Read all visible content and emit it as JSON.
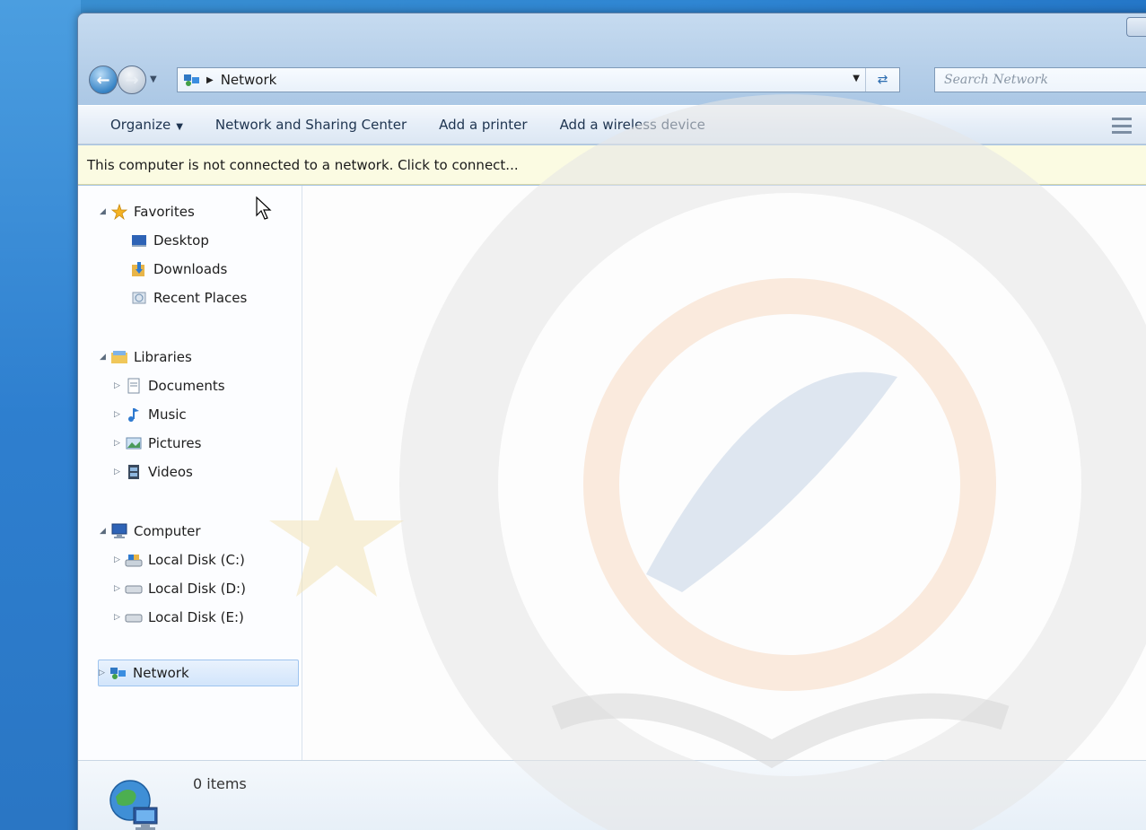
{
  "address_bar": {
    "location": "Network"
  },
  "search": {
    "placeholder": "Search Network"
  },
  "toolbar": {
    "organize": "Organize",
    "network_sharing": "Network and Sharing Center",
    "add_printer": "Add a printer",
    "add_wireless": "Add a wireless device"
  },
  "infobar": {
    "message": "This computer is not connected to a network. Click to connect..."
  },
  "nav_pane": {
    "favorites": {
      "label": "Favorites",
      "items": [
        "Desktop",
        "Downloads",
        "Recent Places"
      ]
    },
    "libraries": {
      "label": "Libraries",
      "items": [
        "Documents",
        "Music",
        "Pictures",
        "Videos"
      ]
    },
    "computer": {
      "label": "Computer",
      "items": [
        "Local Disk (C:)",
        "Local Disk (D:)",
        "Local Disk (E:)"
      ]
    },
    "network": {
      "label": "Network"
    }
  },
  "status": {
    "items_count": "0 items"
  },
  "icons": {
    "back": "back-arrow-icon",
    "forward": "forward-arrow-icon",
    "network": "network-icon",
    "refresh": "refresh-icon",
    "view": "view-options-icon",
    "star": "star-icon",
    "desktop": "desktop-icon",
    "downloads": "downloads-folder-icon",
    "recent": "recent-places-icon",
    "libraries": "libraries-icon",
    "documents": "documents-icon",
    "music": "music-icon",
    "pictures": "pictures-icon",
    "videos": "videos-icon",
    "computer": "computer-icon",
    "drive": "hard-drive-icon",
    "globe": "network-globe-icon"
  },
  "colors": {
    "selection": "#d2e5fb",
    "infobar_bg": "#fbfbe2",
    "title_glass": "#b6cfe9"
  }
}
